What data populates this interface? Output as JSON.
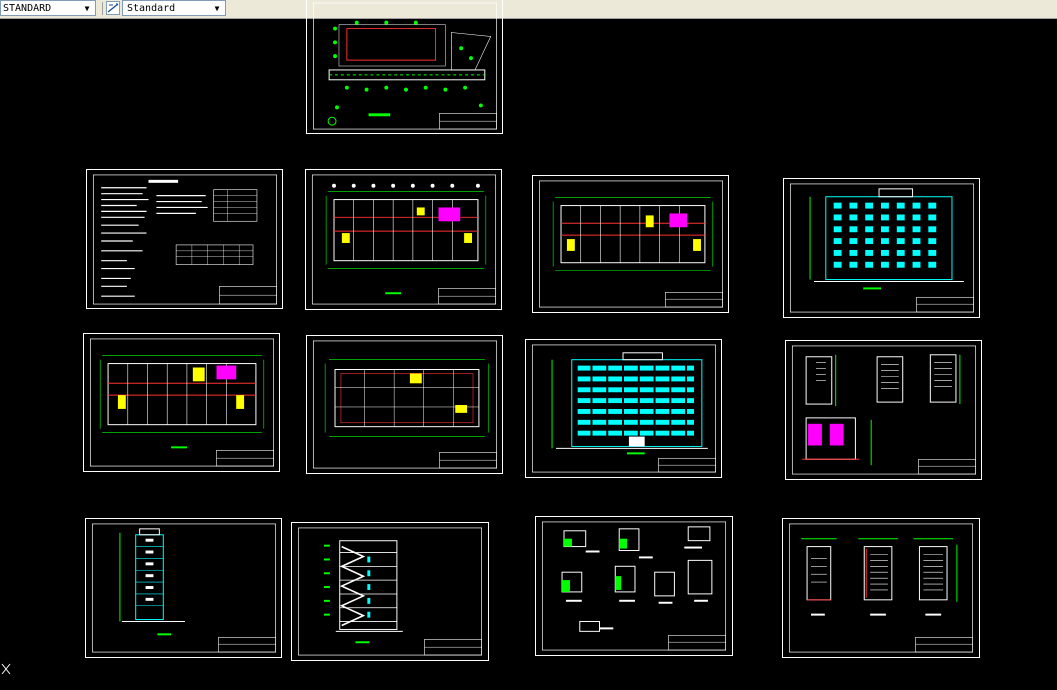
{
  "toolbar": {
    "text_style_value": "STANDARD",
    "dim_style_value": "Standard"
  },
  "icons": {
    "dropdown_arrow": "▼",
    "dim_style_icon": "dimension-style-icon",
    "ucs_icon": "ucs-icon"
  },
  "colors": {
    "canvas": "#000000",
    "sheet_border": "#ffffff",
    "grid_line": "#ffffff",
    "dimension": "#00ff00",
    "wall": "#ff0000",
    "facade": "#00ffff",
    "highlight_yellow": "#ffff00",
    "highlight_magenta": "#ff00ff"
  },
  "sheets": [
    {
      "name": "site-plan"
    },
    {
      "name": "design-notes"
    },
    {
      "name": "floor-plan-1"
    },
    {
      "name": "floor-plan-2"
    },
    {
      "name": "elevation-side"
    },
    {
      "name": "floor-plan-3"
    },
    {
      "name": "roof-plan"
    },
    {
      "name": "elevation-front"
    },
    {
      "name": "stair-details-1"
    },
    {
      "name": "elevation-end"
    },
    {
      "name": "section"
    },
    {
      "name": "node-details"
    },
    {
      "name": "stair-details-2"
    }
  ]
}
